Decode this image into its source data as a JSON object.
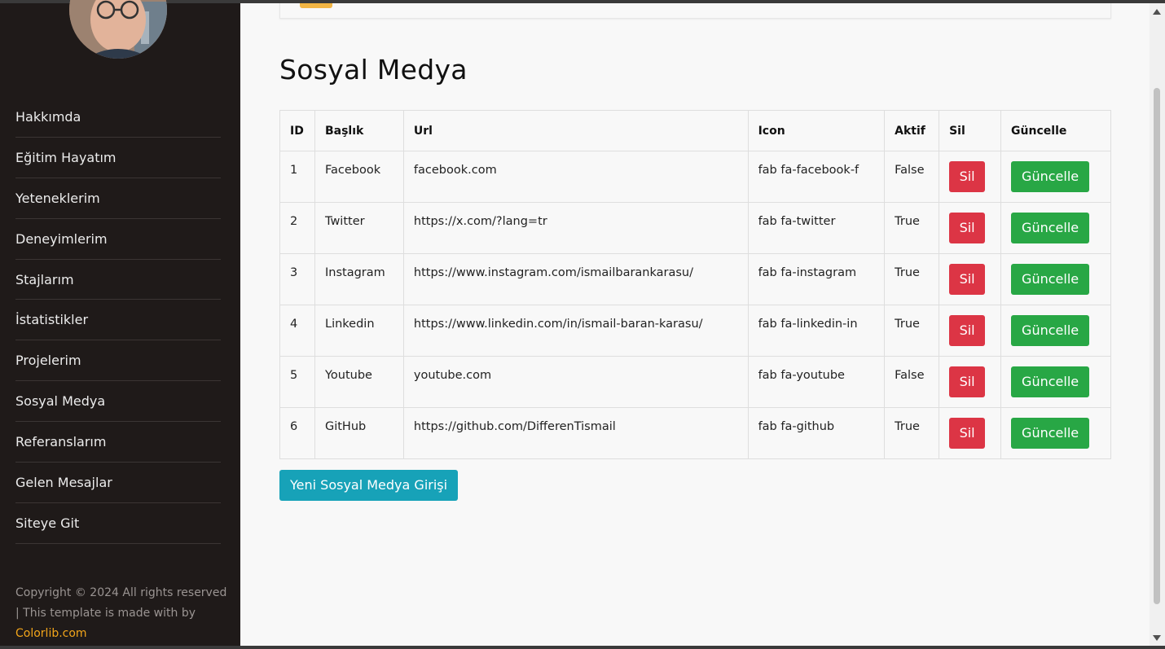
{
  "sidebar": {
    "nav": [
      "Hakkımda",
      "Eğitim Hayatım",
      "Yeteneklerim",
      "Deneyimlerim",
      "Stajlarım",
      "İstatistikler",
      "Projelerim",
      "Sosyal Medya",
      "Referanslarım",
      "Gelen Mesajlar",
      "Siteye Git"
    ],
    "copyright_text": "Copyright © 2024 All rights reserved | This template is made with by",
    "copyright_link": "Colorlib.com"
  },
  "main": {
    "title": "Sosyal Medya",
    "table": {
      "headers": [
        "ID",
        "Başlık",
        "Url",
        "Icon",
        "Aktif",
        "Sil",
        "Güncelle"
      ],
      "rows": [
        {
          "id": "1",
          "title": "Facebook",
          "url": "facebook.com",
          "icon": "fab fa-facebook-f",
          "active": "False"
        },
        {
          "id": "2",
          "title": "Twitter",
          "url": "https://x.com/?lang=tr",
          "icon": "fab fa-twitter",
          "active": "True"
        },
        {
          "id": "3",
          "title": "Instagram",
          "url": "https://www.instagram.com/ismailbarankarasu/",
          "icon": "fab fa-instagram",
          "active": "True"
        },
        {
          "id": "4",
          "title": "Linkedin",
          "url": "https://www.linkedin.com/in/ismail-baran-karasu/",
          "icon": "fab fa-linkedin-in",
          "active": "True"
        },
        {
          "id": "5",
          "title": "Youtube",
          "url": "youtube.com",
          "icon": "fab fa-youtube",
          "active": "False"
        },
        {
          "id": "6",
          "title": "GitHub",
          "url": "https://github.com/DifferenTismail",
          "icon": "fab fa-github",
          "active": "True"
        }
      ],
      "delete_label": "Sil",
      "update_label": "Güncelle"
    },
    "new_button": "Yeni Sosyal Medya Girişi"
  },
  "colors": {
    "sidebar_bg": "#1f1a19",
    "link_accent": "#f2a51a",
    "delete": "#dc3545",
    "update": "#28a745",
    "new": "#17a2b8"
  },
  "icons": [
    "avatar-photo",
    "scroll-up-arrow",
    "scroll-down-arrow"
  ]
}
